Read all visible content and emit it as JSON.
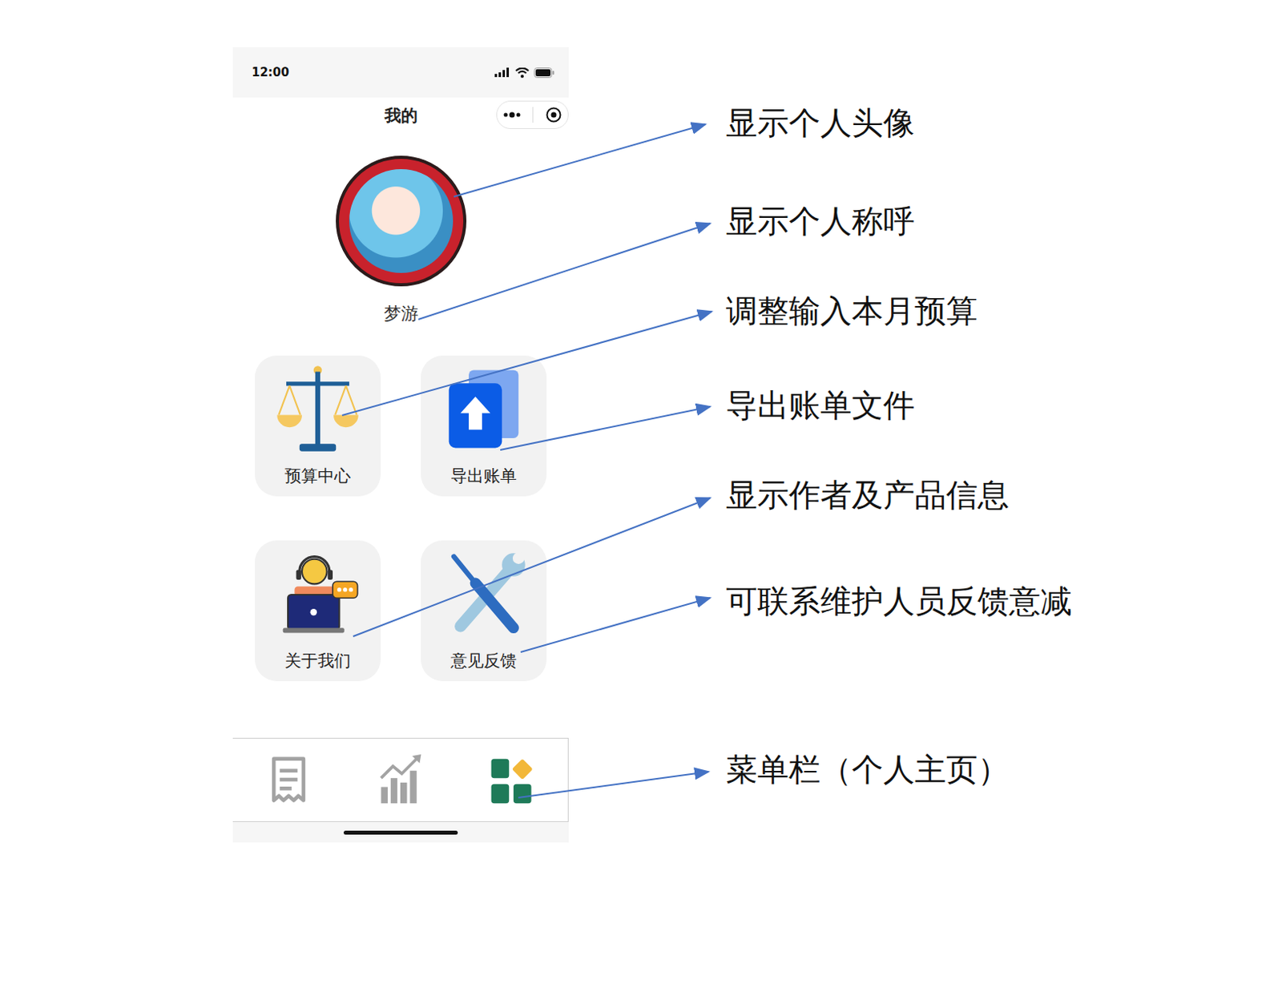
{
  "phone": {
    "status_time": "12:00",
    "title": "我的"
  },
  "profile": {
    "name": "梦游"
  },
  "menu": [
    {
      "label": "预算中心",
      "kind": "budget"
    },
    {
      "label": "导出账单",
      "kind": "export"
    },
    {
      "label": "关于我们",
      "kind": "about"
    },
    {
      "label": "意见反馈",
      "kind": "feedback"
    }
  ],
  "tabbar": [
    {
      "kind": "bills",
      "selected": false
    },
    {
      "kind": "charts",
      "selected": false
    },
    {
      "kind": "mine",
      "selected": true
    }
  ],
  "annotations": [
    {
      "text": "显示个人头像"
    },
    {
      "text": "显示个人称呼"
    },
    {
      "text": "调整输入本月预算"
    },
    {
      "text": "导出账单文件"
    },
    {
      "text": "显示作者及产品信息"
    },
    {
      "text": "可联系维护人员反馈意减"
    },
    {
      "text": "菜单栏（个人主页）"
    }
  ]
}
